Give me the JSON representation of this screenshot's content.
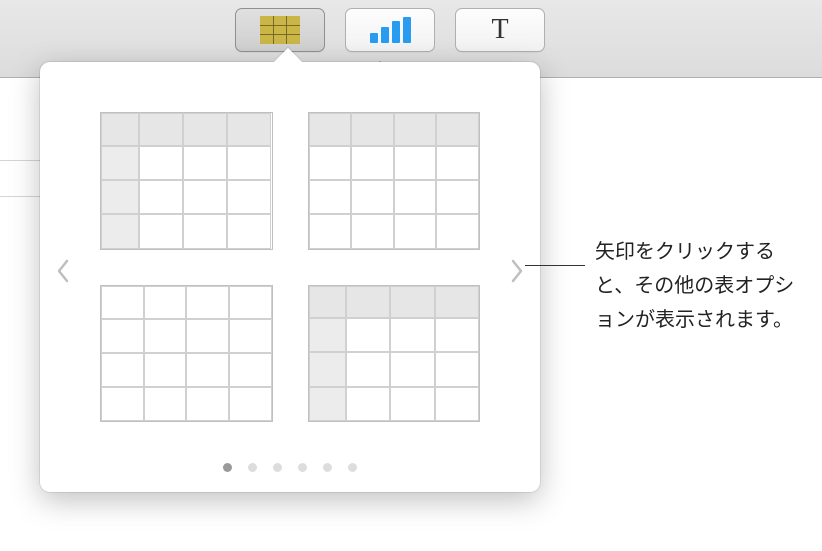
{
  "toolbar": {
    "table": {
      "label": "表"
    },
    "chart": {
      "label": "グラフ"
    },
    "text": {
      "label": "テキスト",
      "glyph": "T"
    }
  },
  "popover": {
    "pages": {
      "count": 6,
      "current": 1
    },
    "nav": {
      "prev": "prev-page",
      "next": "next-page"
    },
    "tableStyles": [
      {
        "id": "style-header-row-and-column"
      },
      {
        "id": "style-header-row"
      },
      {
        "id": "style-plain"
      },
      {
        "id": "style-header-row-and-column-alt"
      }
    ]
  },
  "callouts": {
    "arrow": "矢印をクリックすると、その他の表オプションが表示されます。"
  }
}
